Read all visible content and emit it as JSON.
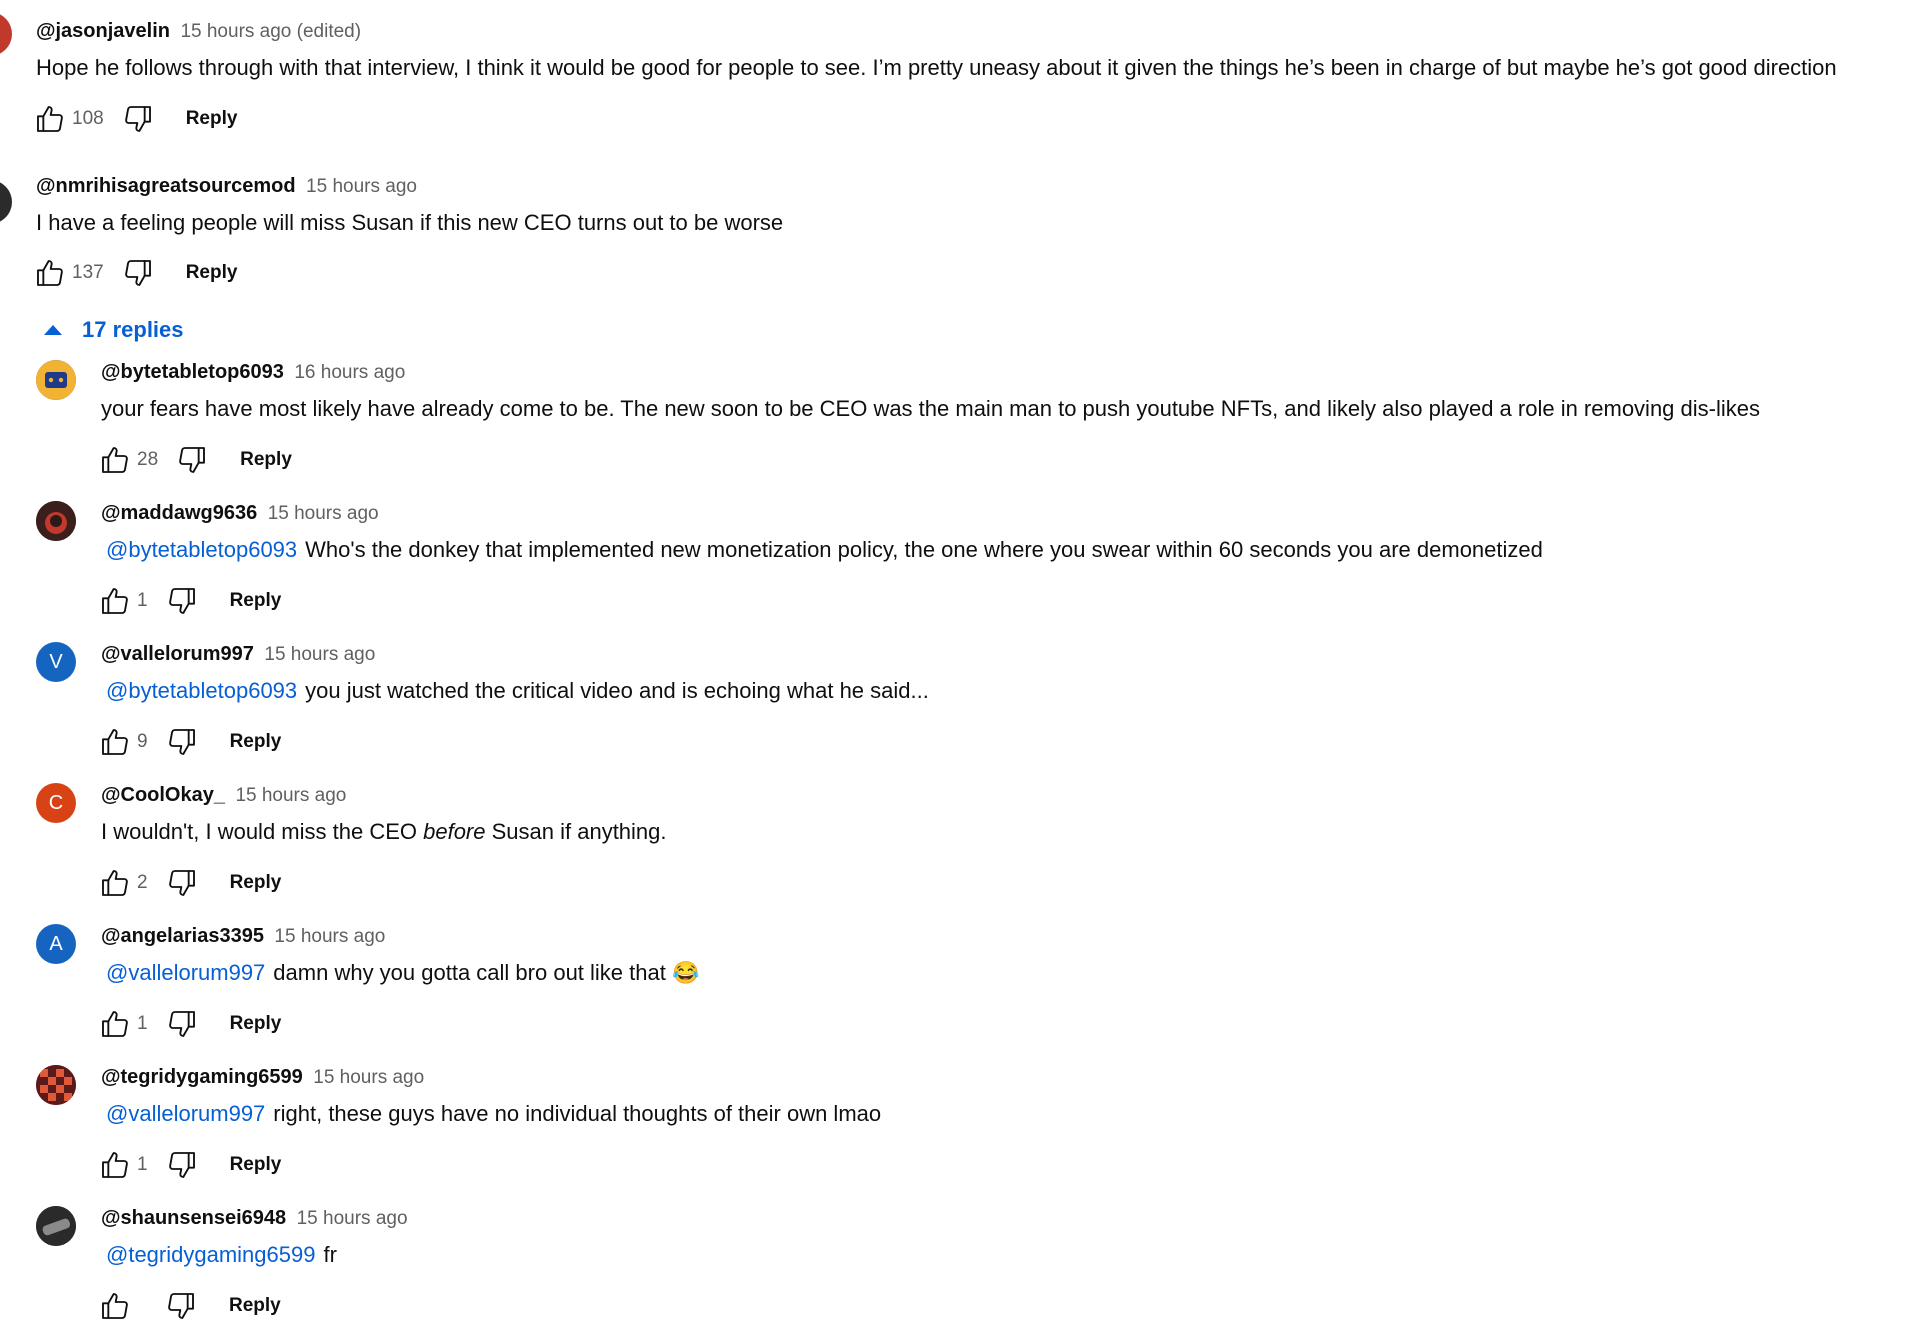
{
  "top_comments": [
    {
      "handle": "@jasonjavelin",
      "time": "15 hours ago (edited)",
      "text": "Hope he follows through with that interview, I think it would be good for people to see. I’m pretty uneasy about it given the things he’s been in charge of but maybe he’s got good direction",
      "likes": "108",
      "reply_label": "Reply",
      "avatar_color": "#c0392b"
    },
    {
      "handle": "@nmrihisagreatsourcemod",
      "time": "15 hours ago",
      "text": "I have a feeling people will miss Susan if this new CEO turns out to be worse",
      "likes": "137",
      "reply_label": "Reply",
      "avatar_color": "#2b2b2b"
    }
  ],
  "replies_toggle": {
    "label": "17 replies"
  },
  "replies": [
    {
      "handle": "@bytetabletop6093",
      "time": "16 hours ago",
      "mention": "",
      "text": "your fears have most likely have already come to be. The new soon to be CEO was the main man to push youtube NFTs, and likely also played a role in removing dis-likes",
      "likes": "28",
      "reply_label": "Reply",
      "avatar_color": "#d9a441",
      "avatar_letter": ""
    },
    {
      "handle": "@maddawg9636",
      "time": "15 hours ago",
      "mention": "@bytetabletop6093",
      "text": "Who's the donkey that implemented new monetization policy, the one where you swear within 60 seconds you are demonetized",
      "likes": "1",
      "reply_label": "Reply",
      "avatar_color": "#5a2e2a",
      "avatar_letter": ""
    },
    {
      "handle": "@vallelorum997",
      "time": "15 hours ago",
      "mention": "@bytetabletop6093",
      "text": "you just watched the critical video and is echoing what he said...",
      "likes": "9",
      "reply_label": "Reply",
      "avatar_color": "#1565c0",
      "avatar_letter": "V"
    },
    {
      "handle": "@CoolOkay_",
      "time": "15 hours ago",
      "mention": "",
      "text_before": "I wouldn't, I would miss the CEO ",
      "text_italic": "before",
      "text_after": " Susan if anything.",
      "likes": "2",
      "reply_label": "Reply",
      "avatar_color": "#d84315",
      "avatar_letter": "C"
    },
    {
      "handle": "@angelarias3395",
      "time": "15 hours ago",
      "mention": "@vallelorum997",
      "text": "damn why you gotta call bro out like that 😂",
      "likes": "1",
      "reply_label": "Reply",
      "avatar_color": "#1565c0",
      "avatar_letter": "A"
    },
    {
      "handle": "@tegridygaming6599",
      "time": "15 hours ago",
      "mention": "@vallelorum997",
      "text": "right, these guys have no individual thoughts of their own lmao",
      "likes": "1",
      "reply_label": "Reply",
      "avatar_color": "#8e2b2b",
      "avatar_letter": ""
    },
    {
      "handle": "@shaunsensei6948",
      "time": "15 hours ago",
      "mention": "@tegridygaming6599",
      "text": "fr",
      "likes": "",
      "reply_label": "Reply",
      "avatar_color": "#3a3a3a",
      "avatar_letter": ""
    }
  ]
}
